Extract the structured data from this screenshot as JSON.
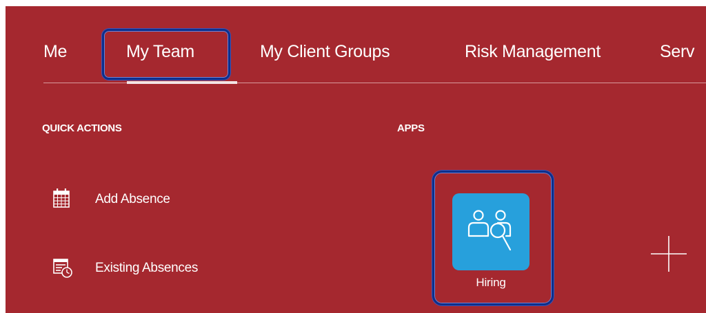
{
  "tabs": {
    "me": "Me",
    "my_team": "My Team",
    "my_client_groups": "My Client Groups",
    "risk_management": "Risk Management",
    "service_partial": "Serv"
  },
  "quick_actions": {
    "title": "QUICK ACTIONS",
    "items": [
      {
        "label": "Add Absence",
        "icon": "calendar-icon"
      },
      {
        "label": "Existing Absences",
        "icon": "calendar-clock-icon"
      }
    ]
  },
  "apps": {
    "title": "APPS",
    "tiles": [
      {
        "label": "Hiring",
        "icon": "people-search-icon",
        "color": "#27a0dc"
      }
    ],
    "add_icon": "plus-icon"
  },
  "colors": {
    "background": "#a5282f",
    "highlight": "#0c2f8c",
    "tile": "#27a0dc"
  }
}
